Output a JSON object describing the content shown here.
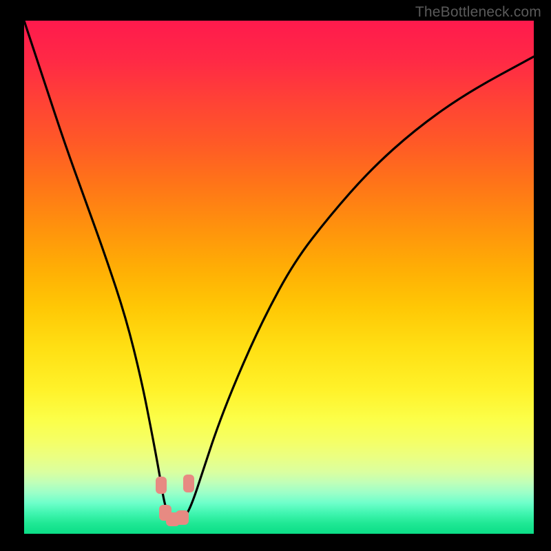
{
  "watermark": "TheBottleneck.com",
  "chart_data": {
    "type": "line",
    "title": "",
    "xlabel": "",
    "ylabel": "",
    "xlim": [
      0,
      100
    ],
    "ylim": [
      0,
      100
    ],
    "grid": false,
    "series": [
      {
        "name": "bottleneck-curve",
        "x": [
          0,
          4,
          8,
          12,
          16,
          20,
          23,
          25,
          26.5,
          27.5,
          28.5,
          30,
          31.5,
          33,
          35,
          38,
          42,
          47,
          53,
          60,
          68,
          77,
          87,
          100
        ],
        "values": [
          100,
          88,
          76,
          65,
          54,
          42,
          30,
          20,
          12,
          6,
          3,
          2,
          3,
          6,
          12,
          21,
          31,
          42,
          53,
          62,
          71,
          79,
          86,
          93
        ]
      }
    ],
    "markers": [
      {
        "name": "left-joint-top",
        "x": 26.9,
        "y": 9.5,
        "w": 2.2,
        "h": 3.4
      },
      {
        "name": "right-joint-top",
        "x": 32.3,
        "y": 9.8,
        "w": 2.2,
        "h": 3.4
      },
      {
        "name": "valley-left",
        "x": 27.7,
        "y": 4.1,
        "w": 2.4,
        "h": 3.2
      },
      {
        "name": "valley-mid-left",
        "x": 29.2,
        "y": 2.8,
        "w": 2.6,
        "h": 2.6
      },
      {
        "name": "valley-mid-right",
        "x": 31.0,
        "y": 3.2,
        "w": 2.6,
        "h": 2.8
      }
    ],
    "background_gradient": {
      "top": "#ff1a4d",
      "mid": "#ffe014",
      "bottom": "#0bdd87"
    },
    "annotations": []
  }
}
